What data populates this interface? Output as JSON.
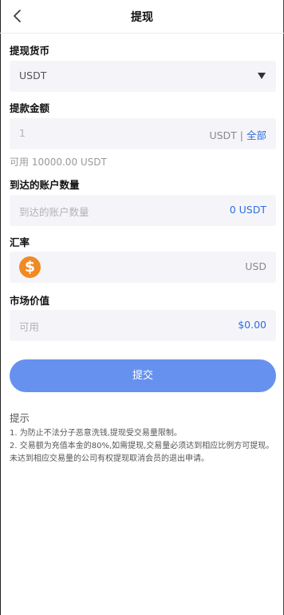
{
  "header": {
    "title": "提现",
    "back_icon": "chevron-left-icon"
  },
  "currency": {
    "label": "提现货币",
    "selected": "USDT",
    "dropdown_icon": "caret-down-icon"
  },
  "amount": {
    "label": "提款金额",
    "placeholder": "1",
    "unit": "USDT",
    "separator": "|",
    "all_label": "全部"
  },
  "available": "可用 10000.00 USDT",
  "received": {
    "label": "到达的账户数量",
    "placeholder": "到达的账户数量",
    "value": "0 USDT"
  },
  "rate": {
    "label": "汇率",
    "unit": "USD",
    "icon": "dollar-coin-icon"
  },
  "market": {
    "label": "市场价值",
    "placeholder": "可用",
    "value": "$0.00"
  },
  "submit_label": "提交",
  "tips": {
    "title": "提示",
    "lines": [
      "1. 为防止不法分子恶意洗钱,提现受交易量限制。",
      "2. 交易额为充值本金的80%,如需提现,交易量必须达到相应比例方可提现。未达到相应交易量的公司有权提现取消会员的退出申请。"
    ]
  },
  "colors": {
    "accent": "#2f6fe0",
    "button": "#6691ee",
    "field_bg": "#f5f5f9",
    "coin": "#f08a24"
  }
}
